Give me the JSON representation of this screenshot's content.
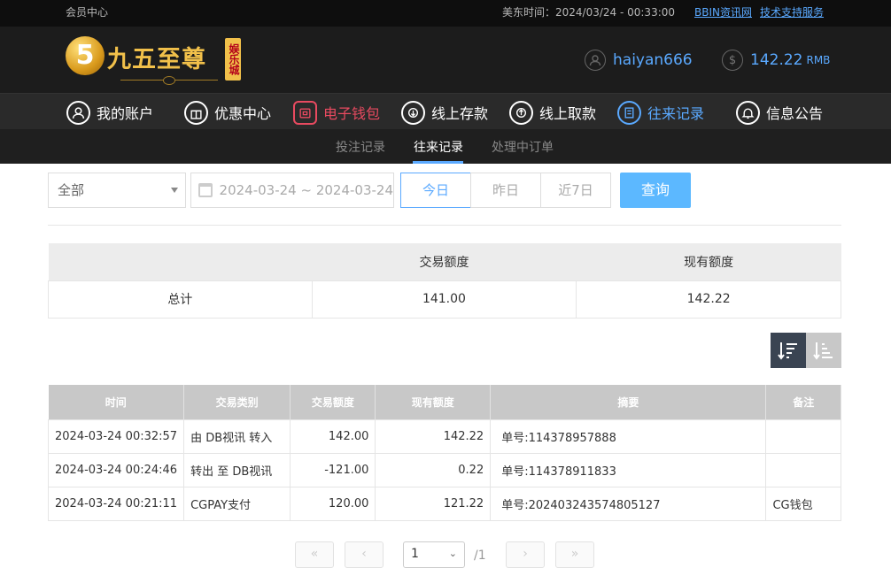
{
  "topbar": {
    "member_center": "会员中心",
    "est_time": "美东时间：2024/03/24 - 00:33:00",
    "link_bbin": "BBIN资讯网",
    "link_support": "技术支持服务"
  },
  "header": {
    "logo_name": "九五至尊",
    "logo_badge": "娱乐城",
    "username": "haiyan666",
    "balance": "142.22",
    "currency": "RMB"
  },
  "nav": {
    "items": [
      {
        "label": "我的账户",
        "icon": "user-icon"
      },
      {
        "label": "优惠中心",
        "icon": "gift-icon"
      },
      {
        "label": "电子钱包",
        "icon": "wallet-icon"
      },
      {
        "label": "线上存款",
        "icon": "deposit-icon"
      },
      {
        "label": "线上取款",
        "icon": "withdraw-icon"
      },
      {
        "label": "往来记录",
        "icon": "records-icon"
      },
      {
        "label": "信息公告",
        "icon": "bell-icon"
      }
    ]
  },
  "subnav": {
    "tabs": [
      "投注记录",
      "往来记录",
      "处理中订单"
    ],
    "active": "往来记录"
  },
  "filters": {
    "type_select": "全部",
    "date_range": "2024-03-24 ~ 2024-03-24",
    "today": "今日",
    "yesterday": "昨日",
    "last7": "近7日",
    "query": "查询"
  },
  "summary": {
    "headers": [
      "",
      "交易额度",
      "现有额度"
    ],
    "row": [
      "总计",
      "141.00",
      "142.22"
    ]
  },
  "records": {
    "headers": [
      "时间",
      "交易类别",
      "交易额度",
      "现有额度",
      "摘要",
      "备注"
    ],
    "rows": [
      [
        "2024-03-24 00:32:57",
        "由 DB视讯 转入",
        "142.00",
        "142.22",
        "单号:114378957888",
        ""
      ],
      [
        "2024-03-24 00:24:46",
        "转出 至 DB视讯",
        "-121.00",
        "0.22",
        "单号:114378911833",
        ""
      ],
      [
        "2024-03-24 00:21:11",
        "CGPAY支付",
        "120.00",
        "121.22",
        "单号:202403243574805127",
        "CG钱包"
      ]
    ]
  },
  "pagination": {
    "current": "1",
    "total": "/1"
  },
  "colors": {
    "accent": "#5aa9ff",
    "wallet_red": "#e84a60",
    "header_bg": "#1c1c1c"
  }
}
